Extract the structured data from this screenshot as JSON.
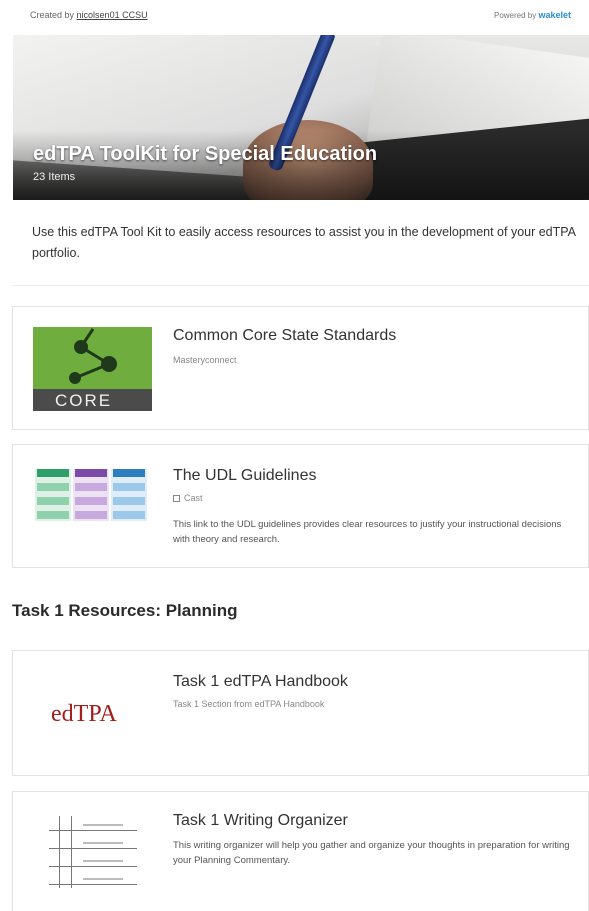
{
  "header": {
    "created_prefix": "Created by",
    "author": "nicolsen01 CCSU",
    "powered_prefix": "Powered by",
    "brand": "wakelet"
  },
  "hero": {
    "title": "edTPA ToolKit for Special Education",
    "count": "23 Items"
  },
  "description": "Use this edTPA Tool Kit to easily access resources to assist you in the development of your edTPA portfolio.",
  "cards": [
    {
      "title": "Common Core State Standards",
      "source": "Masteryconnect",
      "thumb_label": "CORE"
    },
    {
      "title": "The UDL Guidelines",
      "source": "Cast",
      "description": "This link to the UDL guidelines provides clear resources to justify your instructional decisions with theory and research."
    }
  ],
  "section": {
    "title": "Task 1 Resources: Planning"
  },
  "task_cards": [
    {
      "title": "Task 1 edTPA Handbook",
      "source": "Task 1 Section from edTPA Handbook",
      "logo_text": "edTPA"
    },
    {
      "title": "Task 1 Writing Organizer",
      "description": "This writing organizer will help you gather and organize your thoughts in preparation for writing your Planning Commentary."
    }
  ],
  "colors": {
    "brand_blue": "#2a8fd6",
    "core_green": "#6fae3e",
    "edtpa_red": "#a51c1c"
  }
}
